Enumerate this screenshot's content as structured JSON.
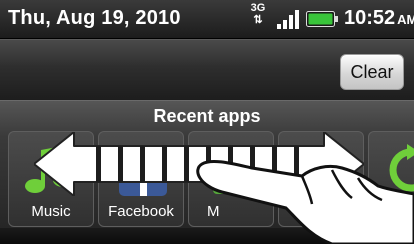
{
  "status_bar": {
    "date": "Thu, Aug 19, 2010",
    "network": "3G",
    "time": "10:52",
    "ampm": "AM",
    "icons": [
      "3g-data-icon",
      "signal-strength-icon",
      "battery-icon"
    ]
  },
  "header": {
    "clear_label": "Clear"
  },
  "recent_apps": {
    "title": "Recent apps",
    "apps": [
      {
        "label": "Music",
        "icon": "music-note-icon"
      },
      {
        "label": "Facebook",
        "icon": "facebook-icon"
      },
      {
        "label": "M",
        "icon": "maps-icon"
      },
      {
        "label": "",
        "icon": "calendar-icon"
      },
      {
        "label": "",
        "icon": "refresh-icon"
      }
    ]
  },
  "overlay": {
    "gesture": "swipe-left-right",
    "icons": [
      "double-arrow-icon",
      "hand-pointer-icon"
    ]
  },
  "colors": {
    "accent_green": "#55a63a",
    "facebook_blue": "#3b5998",
    "battery_green": "#39c43a"
  }
}
